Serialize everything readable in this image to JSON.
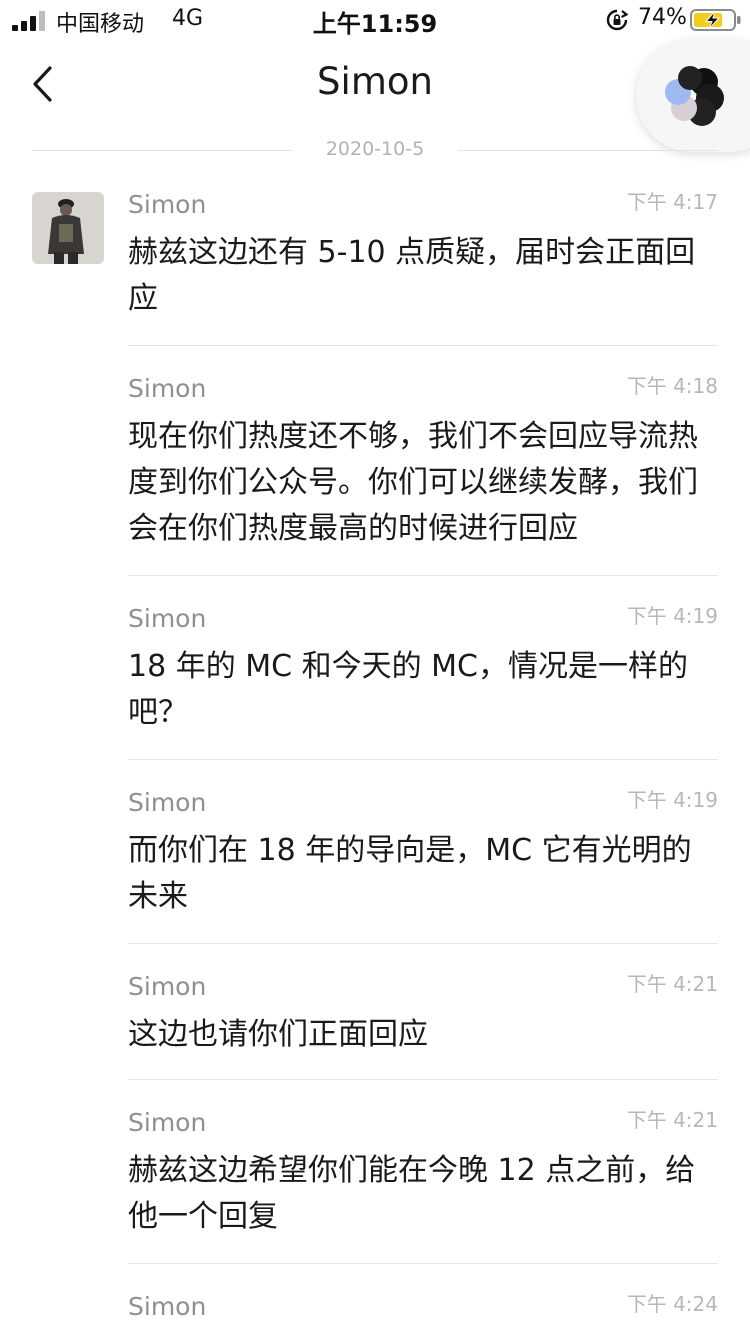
{
  "status_bar": {
    "carrier": "中国移动",
    "network": "4G",
    "time": "上午11:59",
    "battery_percent": "74%",
    "battery_level": 0.74
  },
  "nav": {
    "title": "Simon"
  },
  "date_divider": "2020-10-5",
  "messages": [
    {
      "sender": "Simon",
      "time": "下午 4:17",
      "text": "赫兹这边还有 5-10 点质疑，届时会正面回应"
    },
    {
      "sender": "Simon",
      "time": "下午 4:18",
      "text": "现在你们热度还不够，我们不会回应导流热度到你们公众号。你们可以继续发酵，我们会在你们热度最高的时候进行回应"
    },
    {
      "sender": "Simon",
      "time": "下午 4:19",
      "text": "18 年的 MC 和今天的 MC，情况是一样的吧？"
    },
    {
      "sender": "Simon",
      "time": "下午 4:19",
      "text": "而你们在 18 年的导向是，MC 它有光明的未来"
    },
    {
      "sender": "Simon",
      "time": "下午 4:21",
      "text": "这边也请你们正面回应"
    },
    {
      "sender": "Simon",
      "time": "下午 4:21",
      "text": "赫兹这边希望你们能在今晚 12 点之前，给他一个回复"
    },
    {
      "sender": "Simon",
      "time": "下午 4:24",
      "text": ""
    }
  ]
}
